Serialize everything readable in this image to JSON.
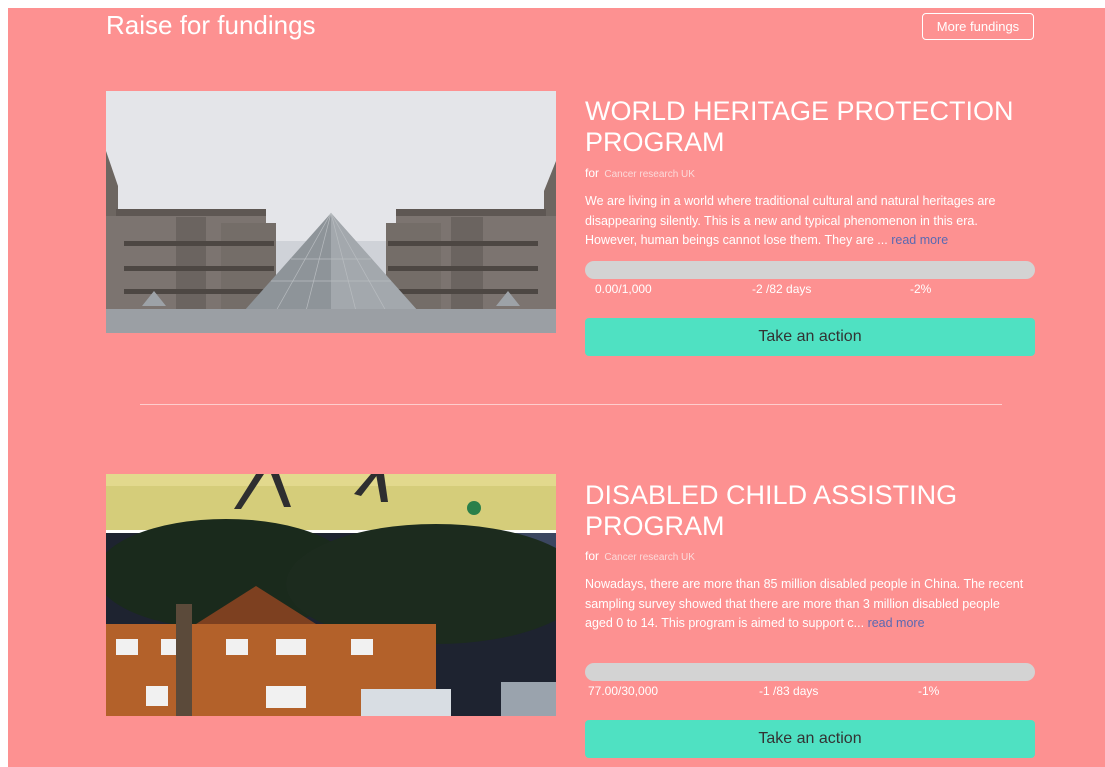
{
  "header": {
    "title": "Raise for fundings",
    "more_label": "More fundings"
  },
  "projects": [
    {
      "title": "WORLD HERITAGE PROTECTION PROGRAM",
      "for_prefix": "for",
      "organization": "Cancer research UK",
      "description": "We are living in a world where traditional cultural and natural heritages are disappearing silently. This is a new and typical phenomenon in this era. However, human beings cannot lose them. They are ... ",
      "read_more": "read more",
      "progress_fraction": 0,
      "raised": "0.00/1,000",
      "days": "-2 /82 days",
      "percent": "-2%",
      "action_label": "Take an action"
    },
    {
      "title": "DISABLED CHILD ASSISTING PROGRAM",
      "for_prefix": "for",
      "organization": "Cancer research UK",
      "description": "Nowadays, there are more than 85 million disabled people in China. The recent sampling survey showed that there are more than 3 million disabled people aged 0 to 14. This program is aimed to support c... ",
      "read_more": "read more",
      "progress_fraction": 0,
      "raised": "77.00/30,000",
      "days": "-1 /83 days",
      "percent": "-1%",
      "action_label": "Take an action"
    }
  ],
  "colors": {
    "background": "#fd9191",
    "accent": "#4fe1c2",
    "link": "#5a69b2",
    "track": "#d3d3d3"
  }
}
